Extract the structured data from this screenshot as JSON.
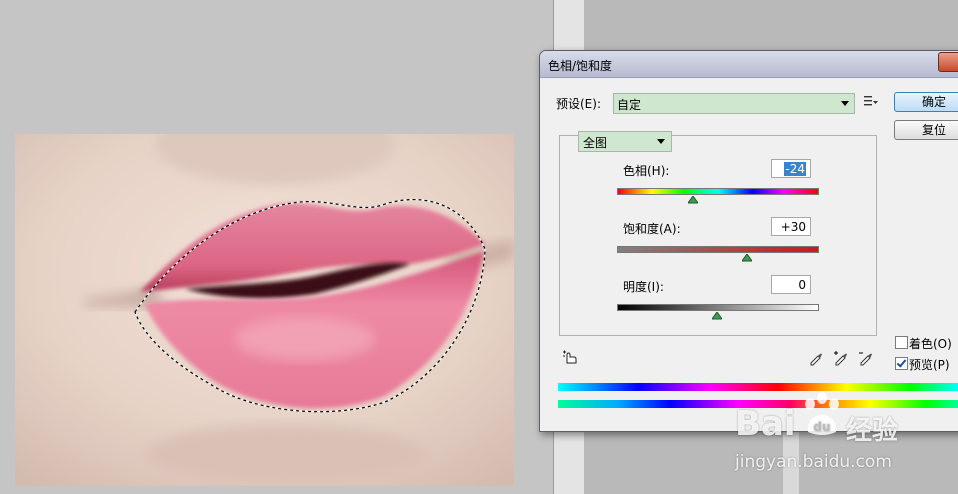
{
  "dialog": {
    "title": "色相/饱和度",
    "preset_label": "预设(E):",
    "preset_value": "自定",
    "ok_label": "确定",
    "reset_label": "复位",
    "channel_value": "全图",
    "hue": {
      "label": "色相(H):",
      "value": "-24",
      "slider_level": 0.38
    },
    "saturation": {
      "label": "饱和度(A):",
      "value": "+30",
      "slider_level": 0.65
    },
    "lightness": {
      "label": "明度(I):",
      "value": "0",
      "slider_level": 0.5
    },
    "colorize_label": "着色(O)",
    "colorize_checked": false,
    "preview_label": "预览(P)",
    "preview_checked": true
  },
  "watermark": {
    "brand_left": "Bai",
    "brand_right": "经验",
    "url": "jingyan.baidu.com"
  },
  "colors": {
    "select_bg": "#cfe6cf",
    "selected_text_bg": "#3a84cf",
    "lips": "#e8708f"
  }
}
